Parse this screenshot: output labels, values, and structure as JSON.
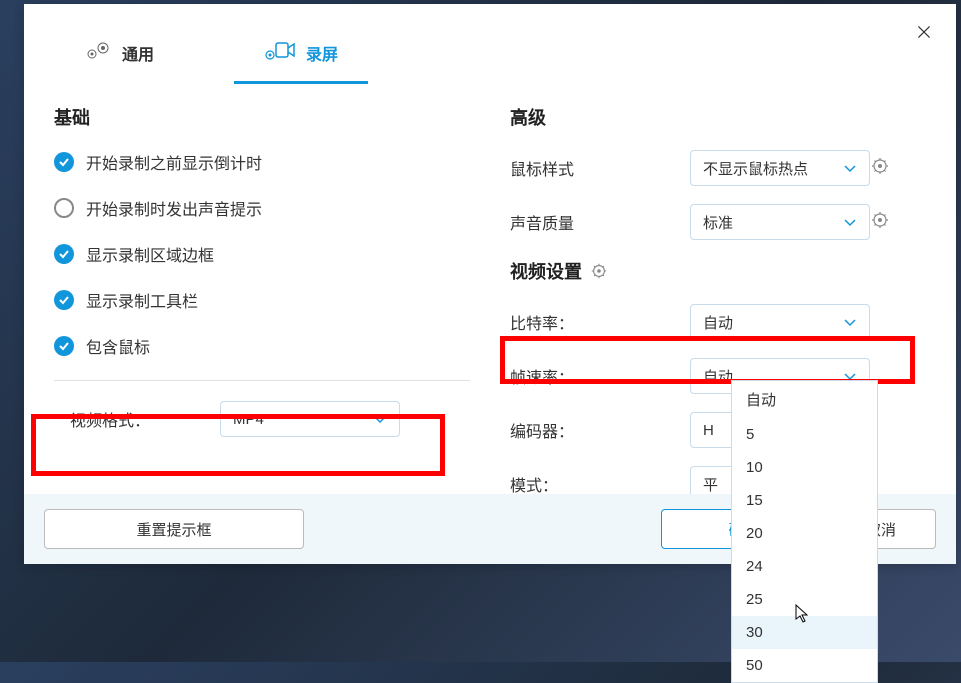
{
  "tabs": {
    "general": "通用",
    "recording": "录屏"
  },
  "basic": {
    "title": "基础",
    "opt1": "开始录制之前显示倒计时",
    "opt2": "开始录制时发出声音提示",
    "opt3": "显示录制区域边框",
    "opt4": "显示录制工具栏",
    "opt5": "包含鼠标"
  },
  "video_format": {
    "label": "视频格式：",
    "value": "MP4"
  },
  "advanced": {
    "title": "高级",
    "mouse_style_label": "鼠标样式",
    "mouse_style_value": "不显示鼠标热点",
    "sound_quality_label": "声音质量",
    "sound_quality_value": "标准",
    "video_settings_title": "视频设置",
    "bitrate_label": "比特率：",
    "bitrate_value": "自动",
    "framerate_label": "帧速率：",
    "framerate_value": "自动",
    "encoder_label": "编码器：",
    "encoder_value": "H",
    "mode_label": "模式：",
    "mode_value": "平"
  },
  "dropdown_options": [
    "自动",
    "5",
    "10",
    "15",
    "20",
    "24",
    "25",
    "30",
    "50"
  ],
  "footer": {
    "reset": "重置提示框",
    "ok": "确",
    "cancel": "取消"
  }
}
